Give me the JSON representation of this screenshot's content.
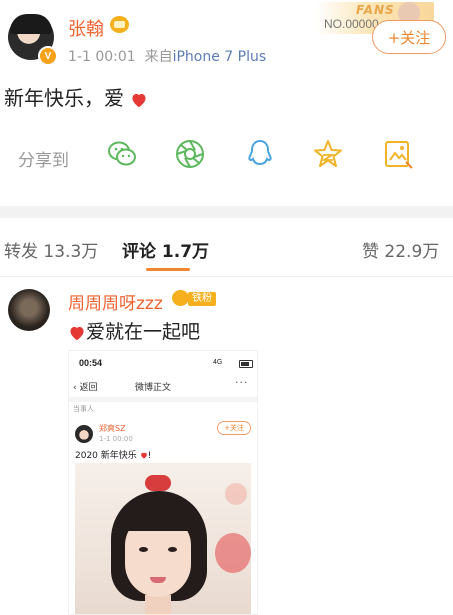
{
  "post": {
    "username": "张翰",
    "time": "1-1 00:01",
    "source_prefix": "来自",
    "source": "iPhone 7 Plus",
    "text": "新年快乐，爱",
    "verified_badge": "V",
    "fans_banner": {
      "text": "FANS",
      "number": "NO.00000"
    },
    "follow_label": "+关注"
  },
  "share": {
    "label": "分享到",
    "targets": [
      "wechat-icon",
      "moments-icon",
      "qq-icon",
      "qzone-icon",
      "album-icon"
    ],
    "color": "#5cb85c"
  },
  "tabs": [
    {
      "label": "转发 13.3万",
      "active": false
    },
    {
      "label": "评论 1.7万",
      "active": true
    },
    {
      "label": "赞 22.9万",
      "active": false
    }
  ],
  "comment": {
    "username": "周周周呀zzz",
    "fan_tag": "铁粉",
    "text": "爱就在一起吧",
    "embedded": {
      "status_time": "00:54",
      "status_right": "4G",
      "back_label": "返回",
      "title": "微博正文",
      "more": "···",
      "sub_label": "当事人",
      "name": "郑爽SZ",
      "date": "1-1 00:00",
      "follow": "+关注",
      "post_text": "2020 新年快乐",
      "post_suffix": "!"
    }
  },
  "colors": {
    "accent": "#f0862f",
    "username": "#f0622f",
    "heart": "#e53935",
    "link": "#5b7db5"
  }
}
